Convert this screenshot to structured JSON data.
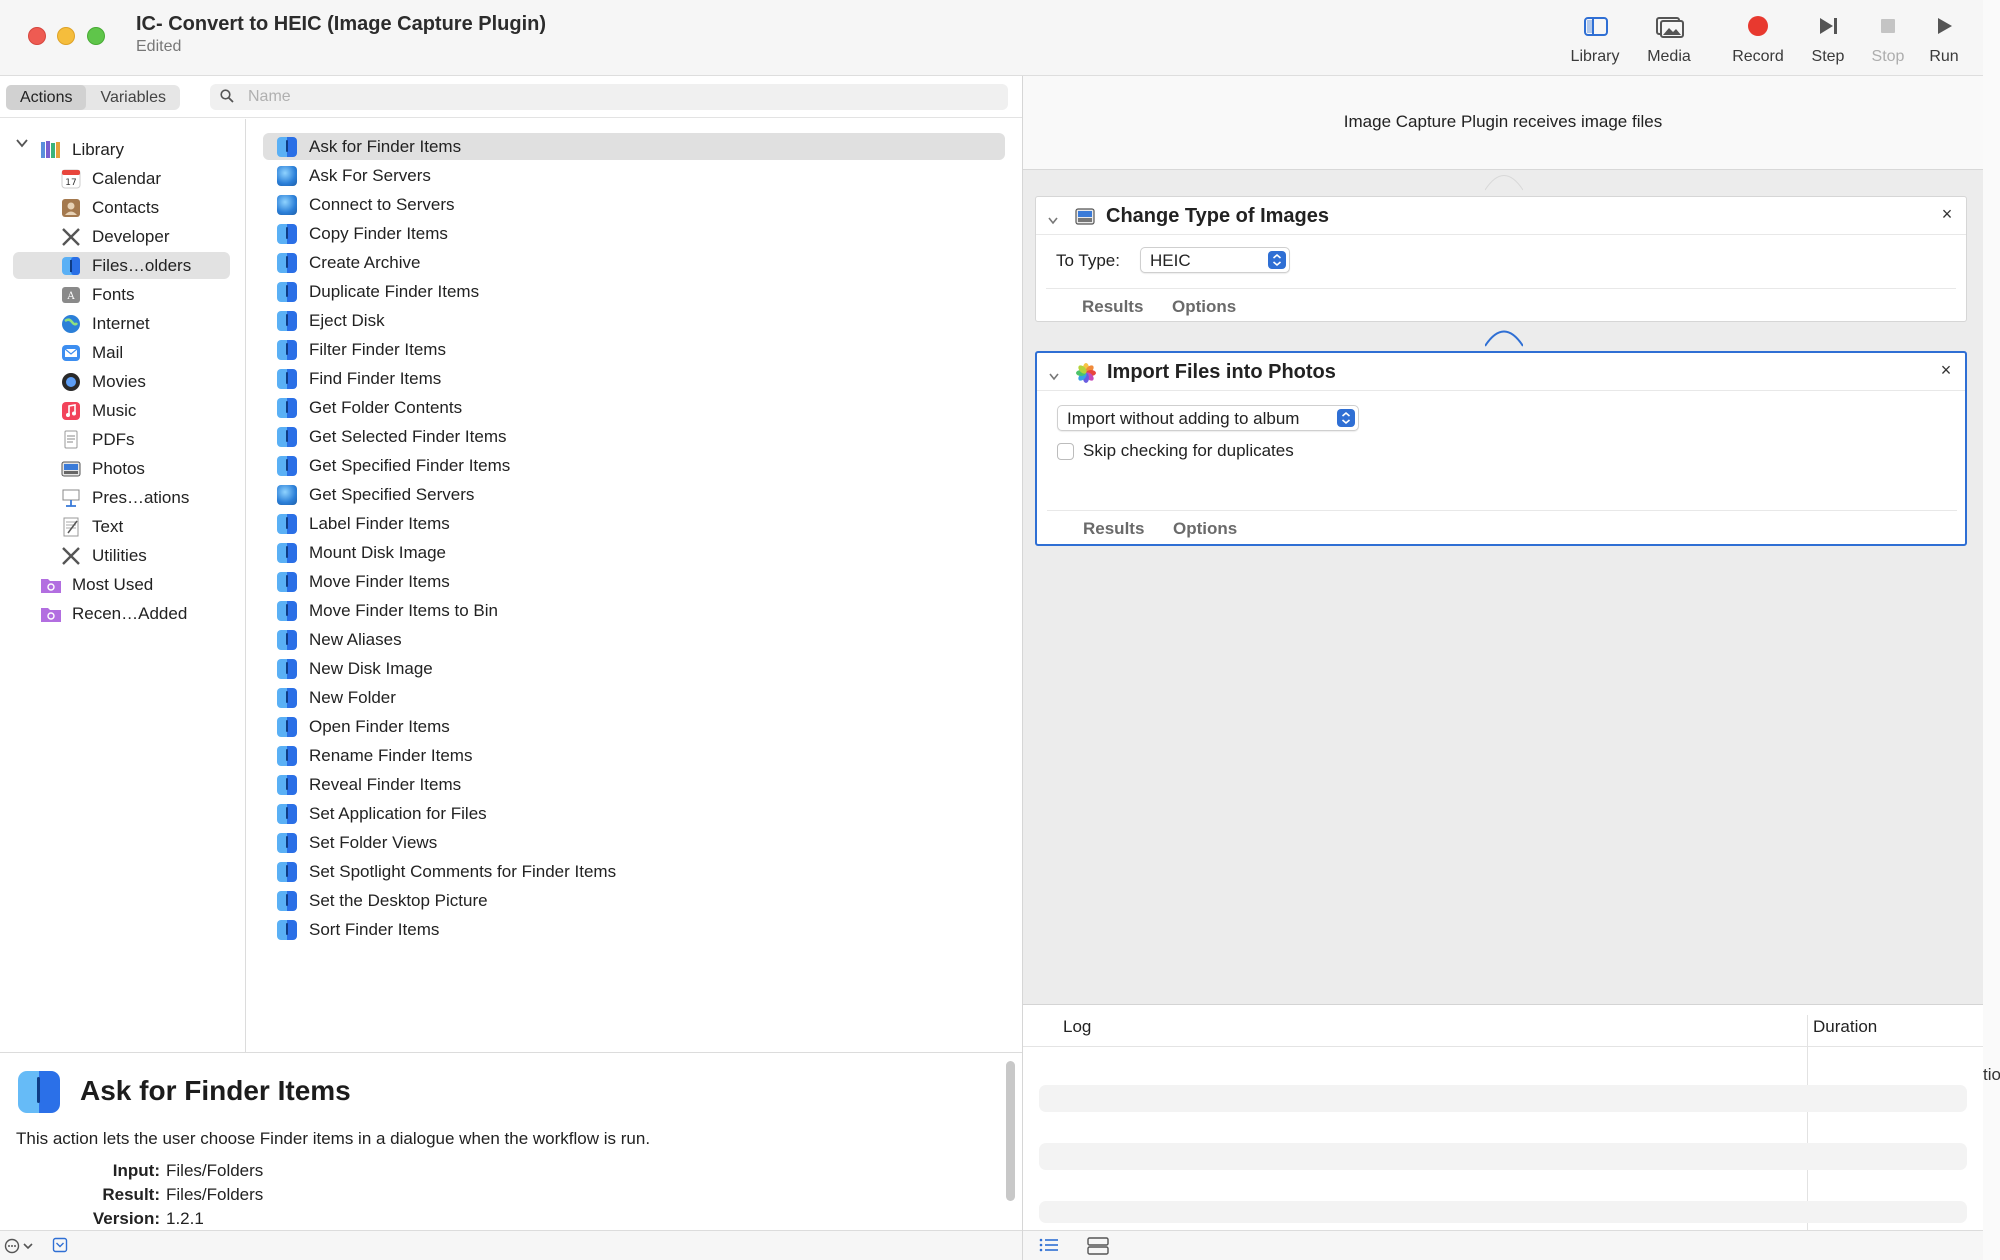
{
  "window": {
    "title": "IC- Convert to HEIC (Image Capture Plugin)",
    "subtitle": "Edited"
  },
  "toolbar": {
    "library": "Library",
    "media": "Media",
    "record": "Record",
    "step": "Step",
    "stop": "Stop",
    "run": "Run"
  },
  "library": {
    "tabs": [
      "Actions",
      "Variables"
    ],
    "search_placeholder": "Name",
    "categories": [
      {
        "label": "Library",
        "icon": "library-icon"
      },
      {
        "label": "Calendar",
        "icon": "calendar-icon"
      },
      {
        "label": "Contacts",
        "icon": "contacts-icon"
      },
      {
        "label": "Developer",
        "icon": "developer-icon"
      },
      {
        "label": "Files…olders",
        "icon": "finder-icon"
      },
      {
        "label": "Fonts",
        "icon": "fonts-icon"
      },
      {
        "label": "Internet",
        "icon": "internet-icon"
      },
      {
        "label": "Mail",
        "icon": "mail-icon"
      },
      {
        "label": "Movies",
        "icon": "movies-icon"
      },
      {
        "label": "Music",
        "icon": "music-icon"
      },
      {
        "label": "PDFs",
        "icon": "pdf-icon"
      },
      {
        "label": "Photos",
        "icon": "photos-icon"
      },
      {
        "label": "Pres…ations",
        "icon": "presentations-icon"
      },
      {
        "label": "Text",
        "icon": "text-icon"
      },
      {
        "label": "Utilities",
        "icon": "utilities-icon"
      },
      {
        "label": "Most Used",
        "icon": "smart-folder-icon"
      },
      {
        "label": "Recen…Added",
        "icon": "smart-folder-icon"
      }
    ],
    "actions": [
      {
        "label": "Ask for Finder Items",
        "icon": "finder"
      },
      {
        "label": "Ask For Servers",
        "icon": "globe"
      },
      {
        "label": "Connect to Servers",
        "icon": "globe"
      },
      {
        "label": "Copy Finder Items",
        "icon": "finder"
      },
      {
        "label": "Create Archive",
        "icon": "finder"
      },
      {
        "label": "Duplicate Finder Items",
        "icon": "finder"
      },
      {
        "label": "Eject Disk",
        "icon": "finder"
      },
      {
        "label": "Filter Finder Items",
        "icon": "finder"
      },
      {
        "label": "Find Finder Items",
        "icon": "finder"
      },
      {
        "label": "Get Folder Contents",
        "icon": "finder"
      },
      {
        "label": "Get Selected Finder Items",
        "icon": "finder"
      },
      {
        "label": "Get Specified Finder Items",
        "icon": "finder"
      },
      {
        "label": "Get Specified Servers",
        "icon": "globe"
      },
      {
        "label": "Label Finder Items",
        "icon": "finder"
      },
      {
        "label": "Mount Disk Image",
        "icon": "finder"
      },
      {
        "label": "Move Finder Items",
        "icon": "finder"
      },
      {
        "label": "Move Finder Items to Bin",
        "icon": "finder"
      },
      {
        "label": "New Aliases",
        "icon": "finder"
      },
      {
        "label": "New Disk Image",
        "icon": "finder"
      },
      {
        "label": "New Folder",
        "icon": "finder"
      },
      {
        "label": "Open Finder Items",
        "icon": "finder"
      },
      {
        "label": "Rename Finder Items",
        "icon": "finder"
      },
      {
        "label": "Reveal Finder Items",
        "icon": "finder"
      },
      {
        "label": "Set Application for Files",
        "icon": "finder"
      },
      {
        "label": "Set Folder Views",
        "icon": "finder"
      },
      {
        "label": "Set Spotlight Comments for Finder Items",
        "icon": "finder"
      },
      {
        "label": "Set the Desktop Picture",
        "icon": "finder"
      },
      {
        "label": "Sort Finder Items",
        "icon": "finder"
      }
    ]
  },
  "description": {
    "title": "Ask for Finder Items",
    "text": "This action lets the user choose Finder items in a dialogue when the workflow is run.",
    "input_key": "Input:",
    "input_val": "Files/Folders",
    "result_key": "Result:",
    "result_val": "Files/Folders",
    "version_key": "Version:",
    "version_val": "1.2.1"
  },
  "workflow": {
    "header": "Image Capture Plugin receives image files",
    "cards": [
      {
        "title": "Change Type of Images",
        "field_label": "To Type:",
        "field_value": "HEIC",
        "tab_results": "Results",
        "tab_options": "Options"
      },
      {
        "title": "Import Files into Photos",
        "popup_value": "Import without adding to album",
        "checkbox_label": "Skip checking for duplicates",
        "checkbox_checked": false,
        "tab_results": "Results",
        "tab_options": "Options"
      }
    ]
  },
  "log": {
    "col_log": "Log",
    "col_duration": "Duration",
    "edge_text": "tio"
  },
  "colors": {
    "accent": "#2f6fd4",
    "record": "#e8392f",
    "selection": "#e0e0e0"
  }
}
